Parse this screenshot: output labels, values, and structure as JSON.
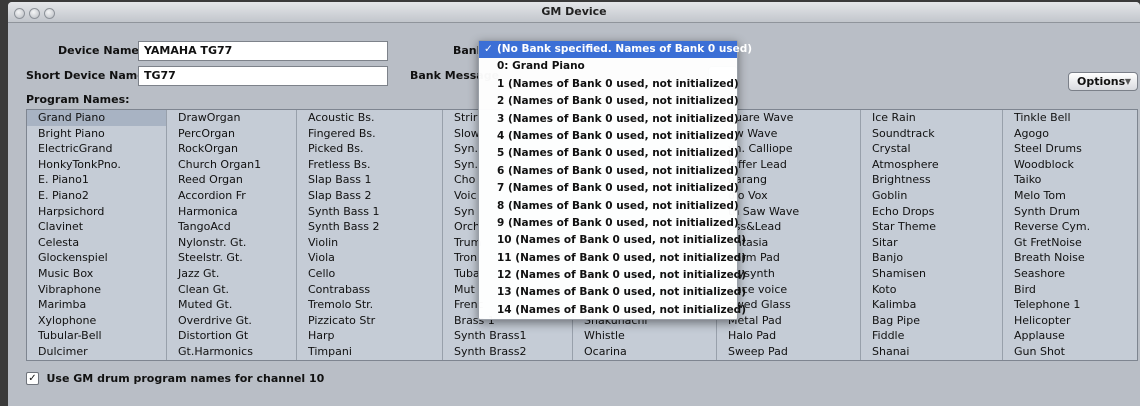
{
  "window": {
    "title": "GM Device"
  },
  "form": {
    "device_name_label": "Device Name:",
    "device_name_value": "YAMAHA TG77",
    "short_device_name_label": "Short Device Name:",
    "short_device_name_value": "TG77",
    "bank_label": "Bank",
    "bank_message_label": "Bank Message",
    "options_label": "Options",
    "program_names_label": "Program Names:"
  },
  "programs": {
    "columns": [
      [
        "Grand Piano",
        "Bright Piano",
        "ElectricGrand",
        "HonkyTonkPno.",
        "E. Piano1",
        "E. Piano2",
        "Harpsichord",
        "Clavinet",
        "Celesta",
        "Glockenspiel",
        "Music Box",
        "Vibraphone",
        "Marimba",
        "Xylophone",
        "Tubular-Bell",
        "Dulcimer"
      ],
      [
        "DrawOrgan",
        "PercOrgan",
        "RockOrgan",
        "Church Organ1",
        "Reed Organ",
        "Accordion Fr",
        "Harmonica",
        "TangoAcd",
        "Nylonstr. Gt.",
        "Steelstr. Gt.",
        "Jazz Gt.",
        "Clean Gt.",
        "Muted Gt.",
        "Overdrive Gt.",
        "Distortion Gt",
        "Gt.Harmonics"
      ],
      [
        "Acoustic Bs.",
        "Fingered Bs.",
        "Picked Bs.",
        "Fretless Bs.",
        "Slap Bass 1",
        "Slap Bass 2",
        "Synth Bass 1",
        "Synth Bass 2",
        "Violin",
        "Viola",
        "Cello",
        "Contrabass",
        "Tremolo Str.",
        "Pizzicato Str",
        "Harp",
        "Timpani"
      ],
      [
        "Strir",
        "Slow",
        "Syn.",
        "Syn.",
        "Cho",
        "Voic",
        "Syn",
        "Orch",
        "Trum",
        "Tron",
        "Tuba",
        "Mut",
        "Frenc",
        "Brass 1",
        "Synth Brass1",
        "Synth Brass2"
      ],
      [
        "",
        "",
        "",
        "",
        "",
        "",
        "",
        "",
        "",
        "",
        "",
        "",
        "",
        "Shakuhachi",
        "Whistle",
        "Ocarina"
      ],
      [
        "quare Wave",
        "aw Wave",
        "yn. Calliope",
        "hiffer Lead",
        "harang",
        "olo Vox",
        "th Saw Wave",
        "ass&Lead",
        "antasia",
        "Varm Pad",
        "olysynth",
        "pace voice",
        "owed Glass",
        "Metal Pad",
        "Halo Pad",
        "Sweep Pad"
      ],
      [
        "Ice Rain",
        "Soundtrack",
        "Crystal",
        "Atmosphere",
        "Brightness",
        "Goblin",
        "Echo Drops",
        "Star Theme",
        "Sitar",
        "Banjo",
        "Shamisen",
        "Koto",
        "Kalimba",
        "Bag Pipe",
        "Fiddle",
        "Shanai"
      ],
      [
        "Tinkle Bell",
        "Agogo",
        "Steel Drums",
        "Woodblock",
        "Taiko",
        "Melo Tom",
        "Synth Drum",
        "Reverse Cym.",
        "Gt FretNoise",
        "Breath Noise",
        "Seashore",
        "Bird",
        "Telephone 1",
        "Helicopter",
        "Applause",
        "Gun Shot"
      ]
    ]
  },
  "drum_checkbox": {
    "label": "Use GM drum program names for channel 10",
    "checked": true
  },
  "bank_menu": {
    "items": [
      "(No Bank specified. Names of Bank 0 used)",
      "0:  Grand Piano",
      "1 (Names of Bank 0 used, not initialized)",
      "2 (Names of Bank 0 used, not initialized)",
      "3 (Names of Bank 0 used, not initialized)",
      "4 (Names of Bank 0 used, not initialized)",
      "5 (Names of Bank 0 used, not initialized)",
      "6 (Names of Bank 0 used, not initialized)",
      "7 (Names of Bank 0 used, not initialized)",
      "8 (Names of Bank 0 used, not initialized)",
      "9 (Names of Bank 0 used, not initialized)",
      "10 (Names of Bank 0 used, not initialized)",
      "11 (Names of Bank 0 used, not initialized)",
      "12 (Names of Bank 0 used, not initialized)",
      "13 (Names of Bank 0 used, not initialized)",
      "14 (Names of Bank 0 used, not initialized)"
    ],
    "selected_index": 0,
    "check_mark": "✓"
  },
  "colors": {
    "menu_highlight": "#3b6fd6",
    "grid_bg": "#c5ccd6",
    "selected_cell": "#a8b3c3"
  }
}
